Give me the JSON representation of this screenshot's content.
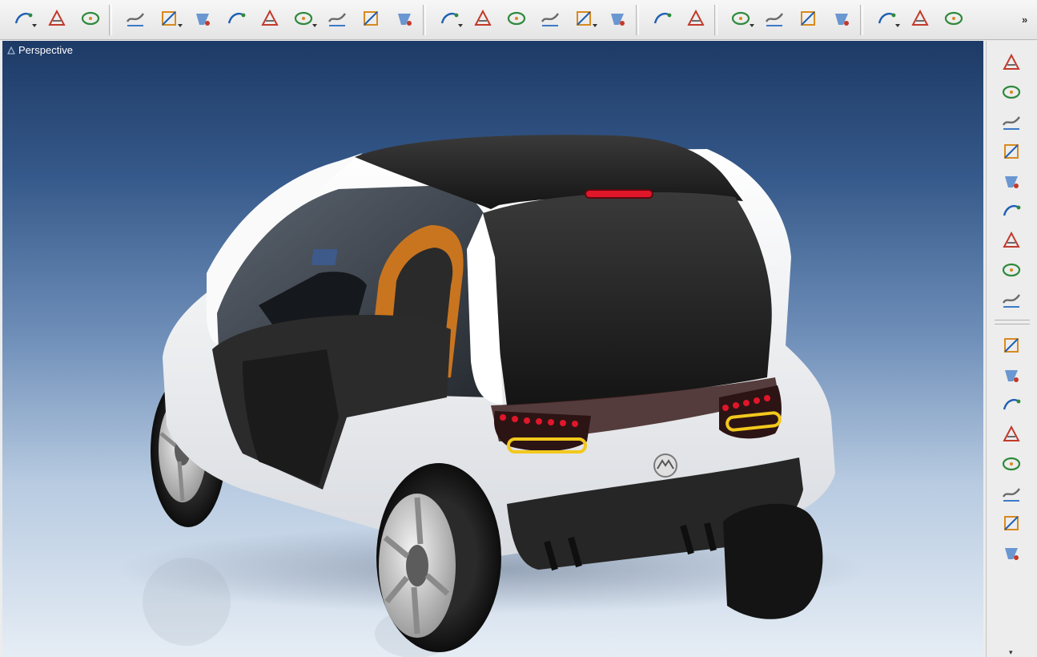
{
  "viewport": {
    "label": "Perspective"
  },
  "toolbar": {
    "groups": [
      [
        "arc-curve",
        "sketch-curve",
        "edit-curve"
      ],
      [
        "patch-surface",
        "sweep-surface",
        "ellipse-curve",
        "blend-surface",
        "freeform-surface",
        "revolve-surface",
        "loft-surface",
        "profile-curve",
        "trim-curve"
      ],
      [
        "fillet-curves",
        "offset-curve",
        "extend-curves",
        "intersect-curves",
        "project-curve",
        "circle-tool"
      ],
      [
        "render-image",
        "edit-shader"
      ],
      [
        "analysis-tool-1",
        "analysis-tool-2",
        "analysis-tool-3",
        "analysis-tool-4"
      ],
      [
        "align-plane",
        "construction-axis",
        "snap-tool"
      ]
    ],
    "more_label": "»"
  },
  "right_panel": {
    "groups": [
      [
        "surface-tool-1",
        "surface-tool-2",
        "surface-tool-3",
        "surface-tool-4",
        "surface-tool-5",
        "surface-tool-6",
        "surface-tool-7",
        "surface-tool-8",
        "surface-tool-9"
      ],
      [
        "solid-tool-1",
        "solid-tool-2",
        "solid-tool-3",
        "solid-tool-4",
        "solid-tool-5",
        "solid-tool-6",
        "node-tool-1",
        "node-tool-2"
      ]
    ],
    "more_label": "▾"
  },
  "colors": {
    "sky_top": "#1e3a66",
    "sky_bottom": "#e6edf5",
    "body_white": "#f4f4f4",
    "roof_black": "#1b1b1b",
    "seat_orange": "#c9751f",
    "tail_red": "#e0162a",
    "indicator_yellow": "#f2c81d"
  }
}
